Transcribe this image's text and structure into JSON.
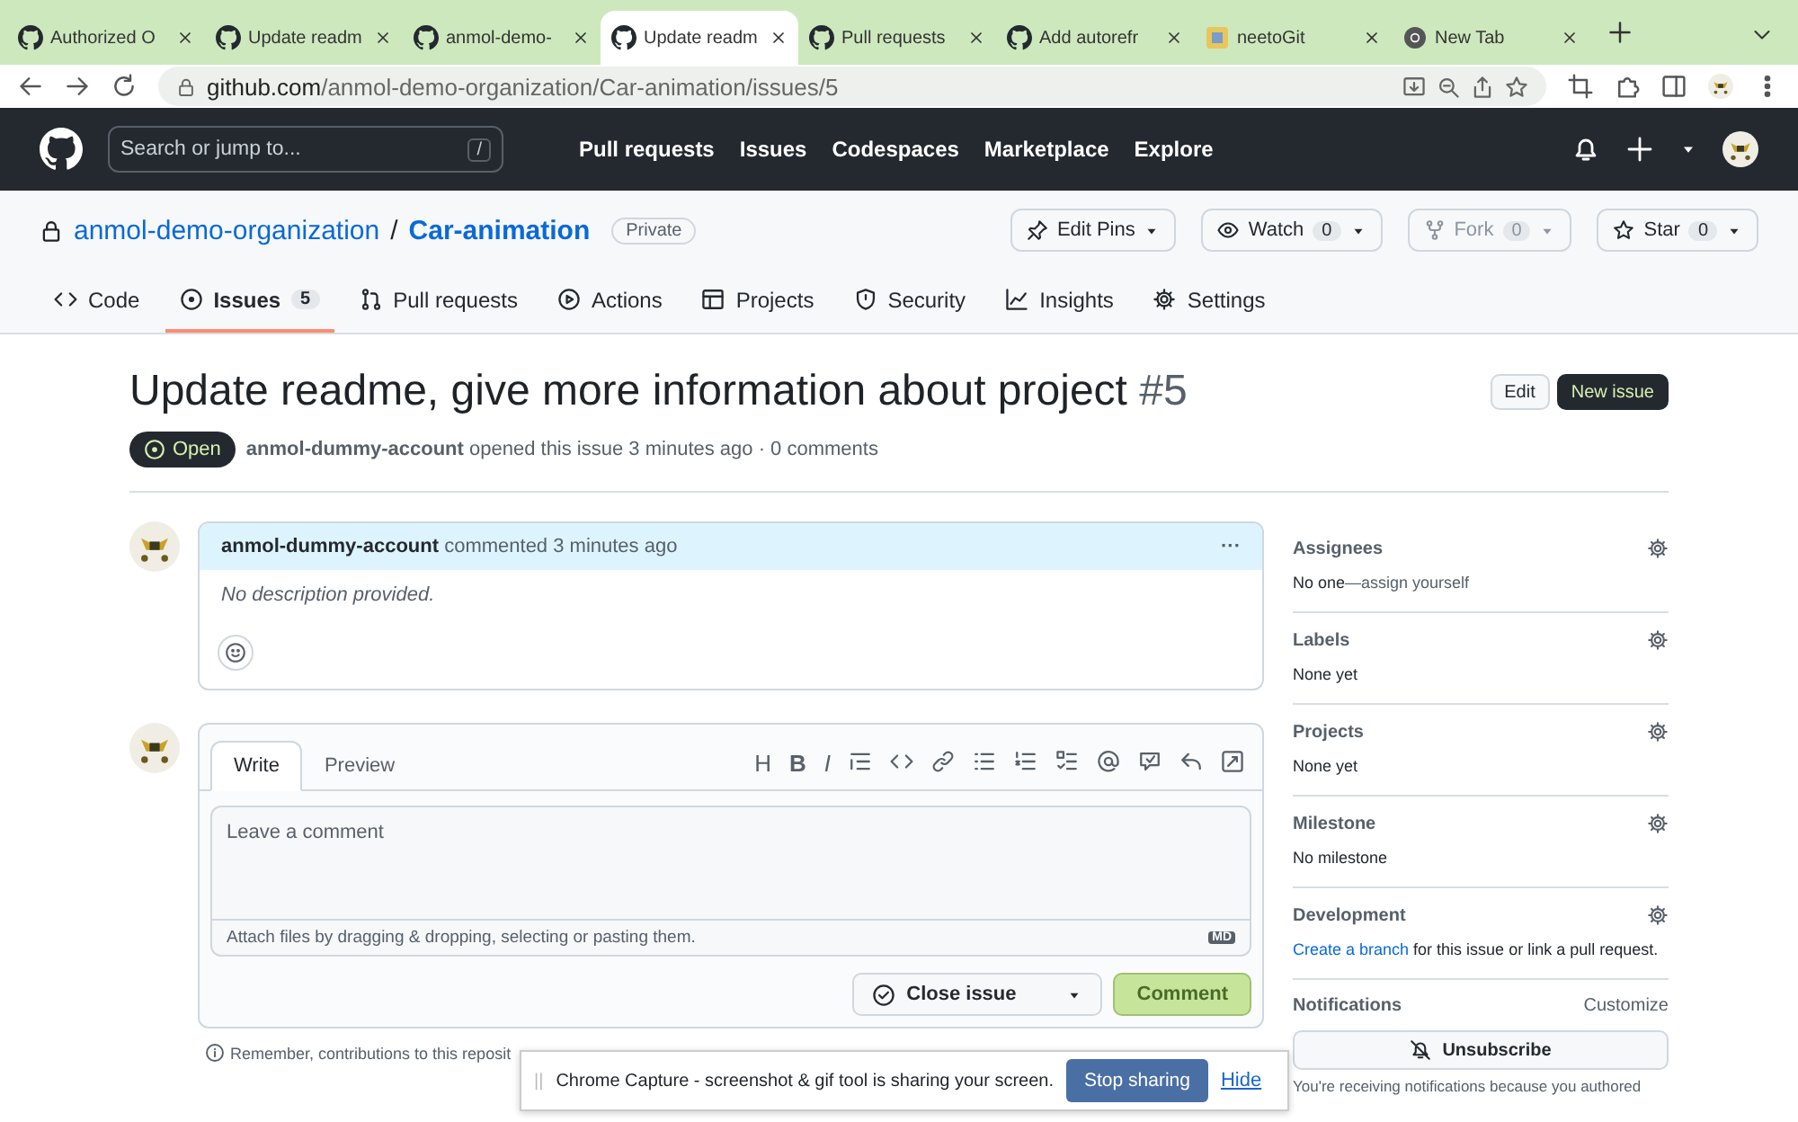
{
  "browser": {
    "tabs": [
      {
        "title": "Authorized O",
        "kind": "github",
        "selected": false
      },
      {
        "title": "Update readm",
        "kind": "github",
        "selected": false
      },
      {
        "title": "anmol-demo-",
        "kind": "github",
        "selected": false
      },
      {
        "title": "Update readm",
        "kind": "github",
        "selected": true
      },
      {
        "title": "Pull requests",
        "kind": "github",
        "selected": false
      },
      {
        "title": "Add autorefr",
        "kind": "github",
        "selected": false
      },
      {
        "title": "neetoGit",
        "kind": "app",
        "selected": false
      },
      {
        "title": "New Tab",
        "kind": "chrome",
        "selected": false
      }
    ],
    "url_host": "github.com",
    "url_path": "/anmol-demo-organization/Car-animation/issues/5"
  },
  "header": {
    "search_placeholder": "Search or jump to...",
    "search_key": "/",
    "links": [
      "Pull requests",
      "Issues",
      "Codespaces",
      "Marketplace",
      "Explore"
    ]
  },
  "repo": {
    "owner": "anmol-demo-organization",
    "separator": "/",
    "name": "Car-animation",
    "visibility": "Private",
    "actions": [
      {
        "kind": "pin",
        "label": "Edit Pins",
        "disabled": false
      },
      {
        "kind": "eye",
        "label": "Watch",
        "count": "0",
        "disabled": false
      },
      {
        "kind": "fork",
        "label": "Fork",
        "count": "0",
        "disabled": true
      },
      {
        "kind": "star",
        "label": "Star",
        "count": "0",
        "disabled": false
      }
    ],
    "tabs": [
      {
        "kind": "code",
        "label": "Code",
        "selected": false
      },
      {
        "kind": "issue",
        "label": "Issues",
        "count": "5",
        "selected": true
      },
      {
        "kind": "pr",
        "label": "Pull requests",
        "selected": false
      },
      {
        "kind": "play",
        "label": "Actions",
        "selected": false
      },
      {
        "kind": "table",
        "label": "Projects",
        "selected": false
      },
      {
        "kind": "shield",
        "label": "Security",
        "selected": false
      },
      {
        "kind": "graph",
        "label": "Insights",
        "selected": false
      },
      {
        "kind": "gear",
        "label": "Settings",
        "selected": false
      }
    ]
  },
  "issue": {
    "title": "Update readme, give more information about project",
    "number": "#5",
    "edit_button": "Edit",
    "new_button": "New issue",
    "state": "Open",
    "author": "anmol-dummy-account",
    "meta": "opened this issue 3 minutes ago · 0 comments"
  },
  "comment": {
    "author": "anmol-dummy-account",
    "meta": "commented 3 minutes ago",
    "menu": "···",
    "body": "No description provided."
  },
  "composer": {
    "tabs": [
      {
        "label": "Write",
        "selected": true
      },
      {
        "label": "Preview",
        "selected": false
      }
    ],
    "toolbar": [
      {
        "kind": "heading",
        "label": "H"
      },
      {
        "kind": "bold",
        "label": "B"
      },
      {
        "kind": "italic",
        "label": "I"
      },
      {
        "kind": "quote"
      },
      {
        "kind": "code"
      },
      {
        "kind": "link"
      },
      {
        "kind": "list"
      },
      {
        "kind": "olist"
      },
      {
        "kind": "tasks"
      },
      {
        "kind": "mention"
      },
      {
        "kind": "ref"
      },
      {
        "kind": "reply"
      },
      {
        "kind": "expand"
      }
    ],
    "placeholder": "Leave a comment",
    "attach": "Attach files by dragging & dropping, selecting or pasting them.",
    "markdown_badge": "MD",
    "close_button": "Close issue",
    "comment_button": "Comment"
  },
  "footer_note": "Remember, contributions to this reposit",
  "sidebar": [
    {
      "title": "Assignees",
      "value": "No one",
      "value_muted": "—assign yourself"
    },
    {
      "title": "Labels",
      "value": "None yet"
    },
    {
      "title": "Projects",
      "value": "None yet"
    },
    {
      "title": "Milestone",
      "value": "No milestone"
    },
    {
      "title": "Development",
      "link": "Create a branch",
      "value": " for this issue or link a pull request."
    }
  ],
  "notifications": {
    "title": "Notifications",
    "action": "Customize",
    "button": "Unsubscribe",
    "note": "You're receiving notifications because you authored"
  },
  "share_bar": {
    "handle": "||",
    "text": "Chrome Capture - screenshot & gif tool is sharing your screen.",
    "stop": "Stop sharing",
    "hide": "Hide"
  }
}
